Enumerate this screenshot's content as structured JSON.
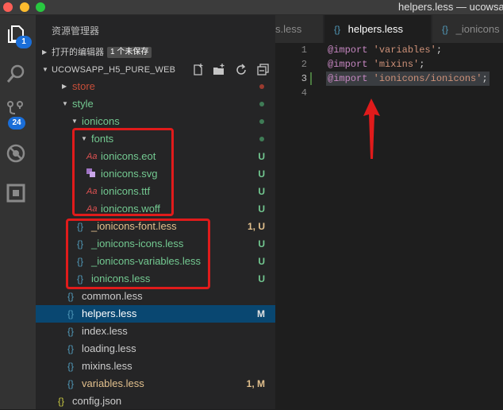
{
  "window": {
    "title": "helpers.less — ucowsa"
  },
  "activity": {
    "explorer_badge": "1",
    "scm_badge": "24"
  },
  "sidebar": {
    "title": "资源管理器",
    "open_editors": {
      "label": "打开的编辑器",
      "unsaved": "1 个未保存"
    },
    "project": {
      "label": "UCOWSAPP_H5_PURE_WEB"
    }
  },
  "tree": [
    {
      "name": "store",
      "icon": "",
      "status": "",
      "dot": true
    },
    {
      "name": "style",
      "icon": "",
      "status": "",
      "dot": true
    },
    {
      "name": "ionicons",
      "icon": "",
      "status": "",
      "dot": true
    },
    {
      "name": "fonts",
      "icon": "",
      "status": "",
      "dot": true
    },
    {
      "name": "ionicons.eot",
      "icon": "𝓐",
      "status": "U"
    },
    {
      "name": "ionicons.svg",
      "icon": "▞",
      "status": "U"
    },
    {
      "name": "ionicons.ttf",
      "icon": "𝓐",
      "status": "U"
    },
    {
      "name": "ionicons.woff",
      "icon": "𝓐",
      "status": "U"
    },
    {
      "name": "_ionicons-font.less",
      "icon": "{}",
      "status": "1, U"
    },
    {
      "name": "_ionicons-icons.less",
      "icon": "{}",
      "status": "U"
    },
    {
      "name": "_ionicons-variables.less",
      "icon": "{}",
      "status": "U"
    },
    {
      "name": "ionicons.less",
      "icon": "{}",
      "status": "U"
    },
    {
      "name": "common.less",
      "icon": "{}",
      "status": ""
    },
    {
      "name": "helpers.less",
      "icon": "{}",
      "status": "M"
    },
    {
      "name": "index.less",
      "icon": "{}",
      "status": ""
    },
    {
      "name": "loading.less",
      "icon": "{}",
      "status": ""
    },
    {
      "name": "mixins.less",
      "icon": "{}",
      "status": ""
    },
    {
      "name": "variables.less",
      "icon": "{}",
      "status": "1, M"
    },
    {
      "name": "config.json",
      "icon": "{}",
      "status": ""
    }
  ],
  "tabs": [
    {
      "label": "s.less"
    },
    {
      "icon": "{}",
      "label": "helpers.less"
    },
    {
      "icon": "{}",
      "label": "_ionicons"
    }
  ],
  "editor": {
    "lines": [
      {
        "num": "1",
        "kw": "@import",
        "str": "'variables'",
        "end": ";"
      },
      {
        "num": "2",
        "kw": "@import",
        "str": "'mixins'",
        "end": ";"
      },
      {
        "num": "3",
        "kw": "@import",
        "str": "'ionicons/ionicons'",
        "end": ";"
      },
      {
        "num": "4",
        "kw": "",
        "str": "",
        "end": ""
      }
    ]
  },
  "colors": {
    "untracked": "#73c991",
    "modified": "#e2c08d",
    "annotation": "#e01b1b",
    "selection": "#094771"
  }
}
